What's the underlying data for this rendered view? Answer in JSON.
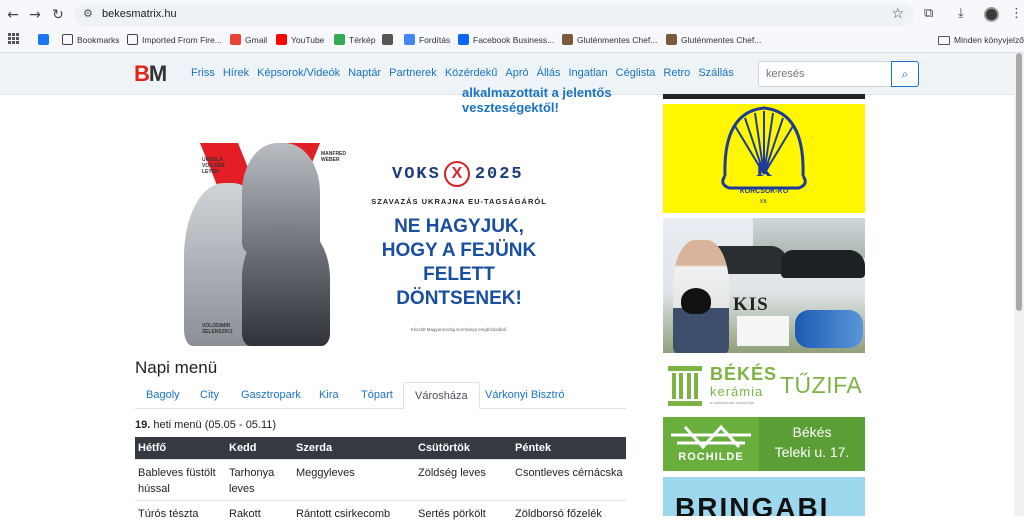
{
  "browser": {
    "url": "bekesmatrix.hu",
    "bookmarks": [
      {
        "label": "",
        "icon": "facebook-icon",
        "color": "#1877f2"
      },
      {
        "label": "Bookmarks",
        "icon": "star-icon",
        "color": "#444"
      },
      {
        "label": "Imported From Fire...",
        "icon": "folder-icon",
        "color": "#444"
      },
      {
        "label": "Gmail",
        "icon": "gmail-icon",
        "color": "#ea4335"
      },
      {
        "label": "YouTube",
        "icon": "youtube-icon",
        "color": "#ff0000"
      },
      {
        "label": "Térkép",
        "icon": "maps-icon",
        "color": "#34a853"
      },
      {
        "label": "",
        "icon": "globe-icon",
        "color": "#555"
      },
      {
        "label": "Fordítás",
        "icon": "translate-icon",
        "color": "#4285f4"
      },
      {
        "label": "Facebook Business...",
        "icon": "meta-icon",
        "color": "#0866ff"
      },
      {
        "label": "Gluténmentes Chef...",
        "icon": "chef-icon",
        "color": "#7a5a3a"
      },
      {
        "label": "Gluténmentes Chef...",
        "icon": "chef-icon",
        "color": "#7a5a3a"
      }
    ],
    "other_bookmarks": "Minden könyvjelző"
  },
  "site": {
    "logo_b": "B",
    "logo_m": "M",
    "nav": [
      "Friss",
      "Hírek",
      "Képsorok/Videók",
      "Naptár",
      "Partnerek",
      "Közérdekű",
      "Apró",
      "Állás",
      "Ingatlan",
      "Céglista",
      "Retro",
      "Szállás"
    ],
    "search_placeholder": "keresés"
  },
  "main": {
    "headline_fragment_line1": "alkalmazottait a jelentős",
    "headline_fragment_line2": "veszteségektől!",
    "ad": {
      "name_left": "URSULA\nVON DER\nLEYEN",
      "name_right": "MANFRED\nWEBER",
      "name_bottom": "VOLODIMIR\nZELENSZKIJ",
      "voks_left": "VOKS",
      "voks_x": "X",
      "voks_right": "2025",
      "subtitle": "SZAVAZÁS UKRAJNA EU-TAGSÁGÁRÓL",
      "slogan_lines": [
        "NE HAGYJUK,",
        "HOGY A FEJÜNK",
        "FELETT",
        "DÖNTSENEK!"
      ],
      "footer": "Készült Magyarország Kormánya megbízásából."
    },
    "menu_title": "Napi menü",
    "tabs": [
      "Bagoly",
      "City",
      "Gasztropark",
      "Kira",
      "Tópart",
      "Városháza",
      "Várkonyi Bisztró"
    ],
    "active_tab": "Városháza",
    "week_number": "19.",
    "week_text": "heti menü (05.05 - 05.11)",
    "table_headers": [
      "Hétfő",
      "Kedd",
      "Szerda",
      "Csütörtök",
      "Péntek"
    ],
    "table_rows": [
      [
        "Bableves füstölt hússal",
        "Tarhonya leves",
        "Meggyleves",
        "Zöldség leves",
        "Csontleves cérnácska"
      ],
      [
        "Túrós tészta",
        "Rakott",
        "Rántott csirkecomb",
        "Sertés pörkölt",
        "Zöldborsó főzelék"
      ]
    ]
  },
  "sidebar": {
    "korcsok_text": "KORCSOK-KŐ",
    "korcsok_sub": "Kft.",
    "kis_label": "KIS",
    "bekes_keramia_line1": "BÉKÉS",
    "bekes_keramia_line2": "kerámia",
    "bekes_keramia_tagline": "a barkácsolás szakértője",
    "tuzifa": "TŰZIFA",
    "rochilde": "ROCHILDE",
    "teleki_line1": "Békés",
    "teleki_line2": "Teleki u. 17.",
    "bringabi": "BRINGABI"
  }
}
